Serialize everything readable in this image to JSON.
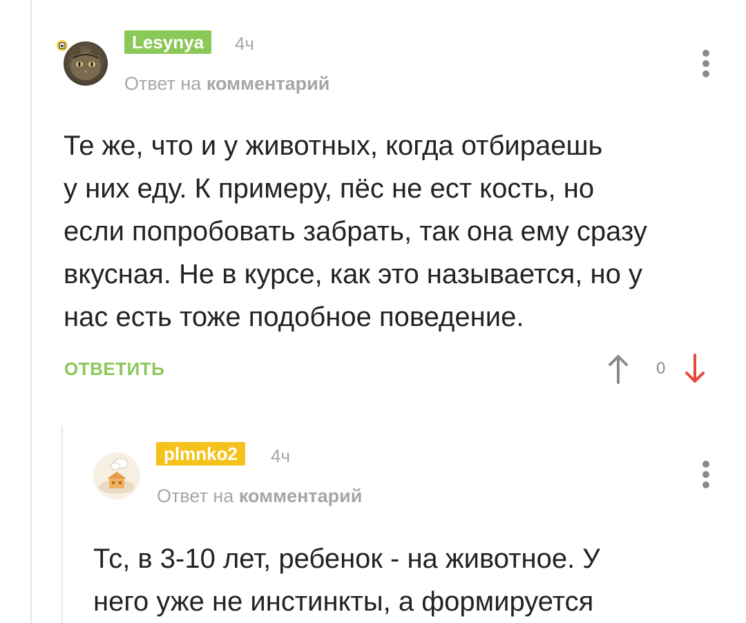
{
  "colors": {
    "green": "#8ac858",
    "yellow": "#f4c21b",
    "muted": "#a6a6a6",
    "downvote": "#e8473b"
  },
  "comments": [
    {
      "username": "Lesynya",
      "username_color": "#8ac858",
      "time": "4ч",
      "reply_prefix": "Ответ на",
      "reply_link": "комментарий",
      "text": "Те же, что и у животных, когда отбираешь\nу них еду. К примеру, пёс не ест кость, но\nесли попробовать забрать, так она ему сразу\nвкусная. Не в курсе, как это называется, но у\nнас есть тоже подобное поведение.",
      "reply_label": "ОТВЕТИТЬ",
      "score": "0"
    },
    {
      "username": "plmnko2",
      "username_color": "#f4c21b",
      "time": "4ч",
      "reply_prefix": "Ответ на",
      "reply_link": "комментарий",
      "text": "Тс, в 3-10 лет, ребенок - на животное. У\nнего уже не инстинкты, а формируется"
    }
  ]
}
